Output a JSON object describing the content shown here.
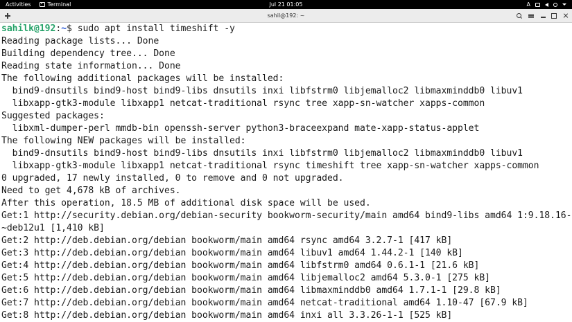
{
  "topbar": {
    "activities": "Activities",
    "app_name": "Terminal",
    "clock": "Jul 21  01:05",
    "input_indicator": "A"
  },
  "window": {
    "title": "sahil@192: ~"
  },
  "prompt": {
    "user_host": "sahilk@192",
    "separator": ":",
    "path": "~",
    "symbol": "$ ",
    "command": "sudo apt install timeshift -y"
  },
  "output_lines": [
    "Reading package lists... Done",
    "Building dependency tree... Done",
    "Reading state information... Done",
    "The following additional packages will be installed:",
    "  bind9-dnsutils bind9-host bind9-libs dnsutils inxi libfstrm0 libjemalloc2 libmaxminddb0 libuv1",
    "  libxapp-gtk3-module libxapp1 netcat-traditional rsync tree xapp-sn-watcher xapps-common",
    "Suggested packages:",
    "  libxml-dumper-perl mmdb-bin openssh-server python3-braceexpand mate-xapp-status-applet",
    "The following NEW packages will be installed:",
    "  bind9-dnsutils bind9-host bind9-libs dnsutils inxi libfstrm0 libjemalloc2 libmaxminddb0 libuv1",
    "  libxapp-gtk3-module libxapp1 netcat-traditional rsync timeshift tree xapp-sn-watcher xapps-common",
    "0 upgraded, 17 newly installed, 0 to remove and 0 not upgraded.",
    "Need to get 4,678 kB of archives.",
    "After this operation, 18.5 MB of additional disk space will be used.",
    "Get:1 http://security.debian.org/debian-security bookworm-security/main amd64 bind9-libs amd64 1:9.18.16-",
    "~deb12u1 [1,410 kB]",
    "Get:2 http://deb.debian.org/debian bookworm/main amd64 rsync amd64 3.2.7-1 [417 kB]",
    "Get:3 http://deb.debian.org/debian bookworm/main amd64 libuv1 amd64 1.44.2-1 [140 kB]",
    "Get:4 http://deb.debian.org/debian bookworm/main amd64 libfstrm0 amd64 0.6.1-1 [21.6 kB]",
    "Get:5 http://deb.debian.org/debian bookworm/main amd64 libjemalloc2 amd64 5.3.0-1 [275 kB]",
    "Get:6 http://deb.debian.org/debian bookworm/main amd64 libmaxminddb0 amd64 1.7.1-1 [29.8 kB]",
    "Get:7 http://deb.debian.org/debian bookworm/main amd64 netcat-traditional amd64 1.10-47 [67.9 kB]",
    "Get:8 http://deb.debian.org/debian bookworm/main amd64 inxi all 3.3.26-1-1 [525 kB]"
  ]
}
